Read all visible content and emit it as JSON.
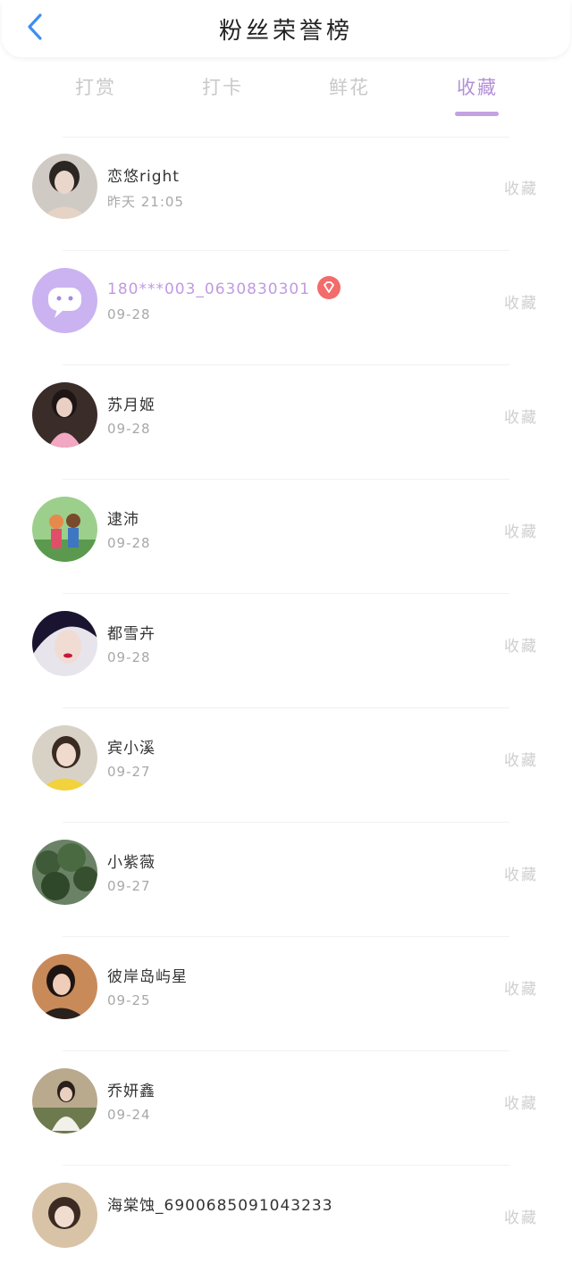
{
  "header": {
    "title": "粉丝荣誉榜"
  },
  "tabs": [
    {
      "label": "打赏",
      "active": false
    },
    {
      "label": "打卡",
      "active": false
    },
    {
      "label": "鲜花",
      "active": false
    },
    {
      "label": "收藏",
      "active": true
    }
  ],
  "fans": [
    {
      "name": "恋悠right",
      "time": "昨天 21:05",
      "action": "收藏"
    },
    {
      "name": "180***003_0630830301",
      "time": "09-28",
      "action": "收藏"
    },
    {
      "name": "苏月姬",
      "time": "09-28",
      "action": "收藏"
    },
    {
      "name": "逮沛",
      "time": "09-28",
      "action": "收藏"
    },
    {
      "name": "都雪卉",
      "time": "09-28",
      "action": "收藏"
    },
    {
      "name": "宾小溪",
      "time": "09-27",
      "action": "收藏"
    },
    {
      "name": "小紫薇",
      "time": "09-27",
      "action": "收藏"
    },
    {
      "name": "彼岸岛屿星",
      "time": "09-25",
      "action": "收藏"
    },
    {
      "name": "乔妍鑫",
      "time": "09-24",
      "action": "收藏"
    },
    {
      "name": "海棠蚀_6900685091043233",
      "time": "",
      "action": "收藏"
    }
  ],
  "colors": {
    "accent": "#b38fd6",
    "vip_badge": "#f36b6b",
    "back_arrow": "#3d8ff0"
  }
}
